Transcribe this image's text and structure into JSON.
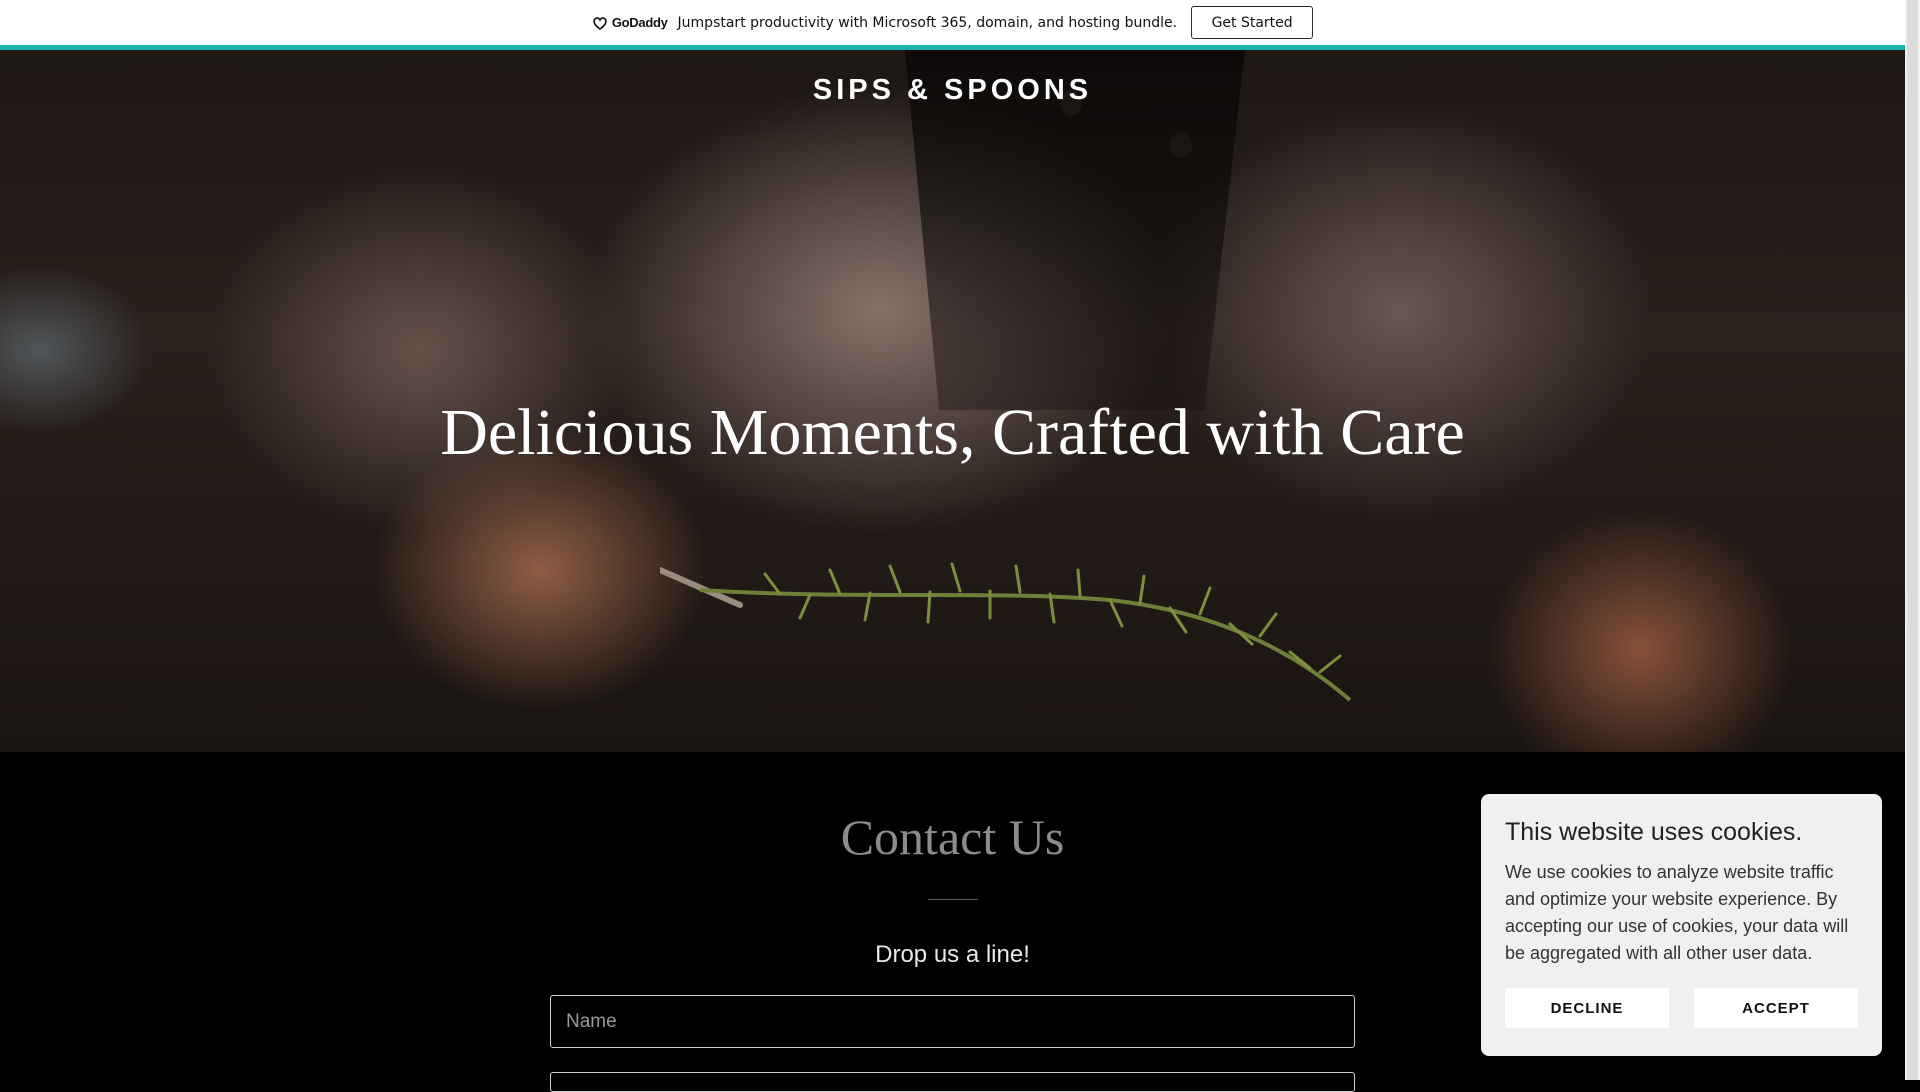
{
  "promo": {
    "logo_text": "GoDaddy",
    "message": "Jumpstart productivity with Microsoft 365, domain, and hosting bundle.",
    "cta_label": "Get Started"
  },
  "hero": {
    "brand": "SIPS & SPOONS",
    "headline": "Delicious Moments, Crafted with Care"
  },
  "contact": {
    "title": "Contact Us",
    "subtitle": "Drop us a line!",
    "name_placeholder": "Name"
  },
  "cookie": {
    "title": "This website uses cookies.",
    "body": "We use cookies to analyze website traffic and optimize your website experience. By accepting our use of cookies, your data will be aggregated with all other user data.",
    "decline_label": "DECLINE",
    "accept_label": "ACCEPT"
  },
  "colors": {
    "accent": "#1bb3b0",
    "background": "#000000",
    "cookie_card": "#f0f0f0"
  }
}
